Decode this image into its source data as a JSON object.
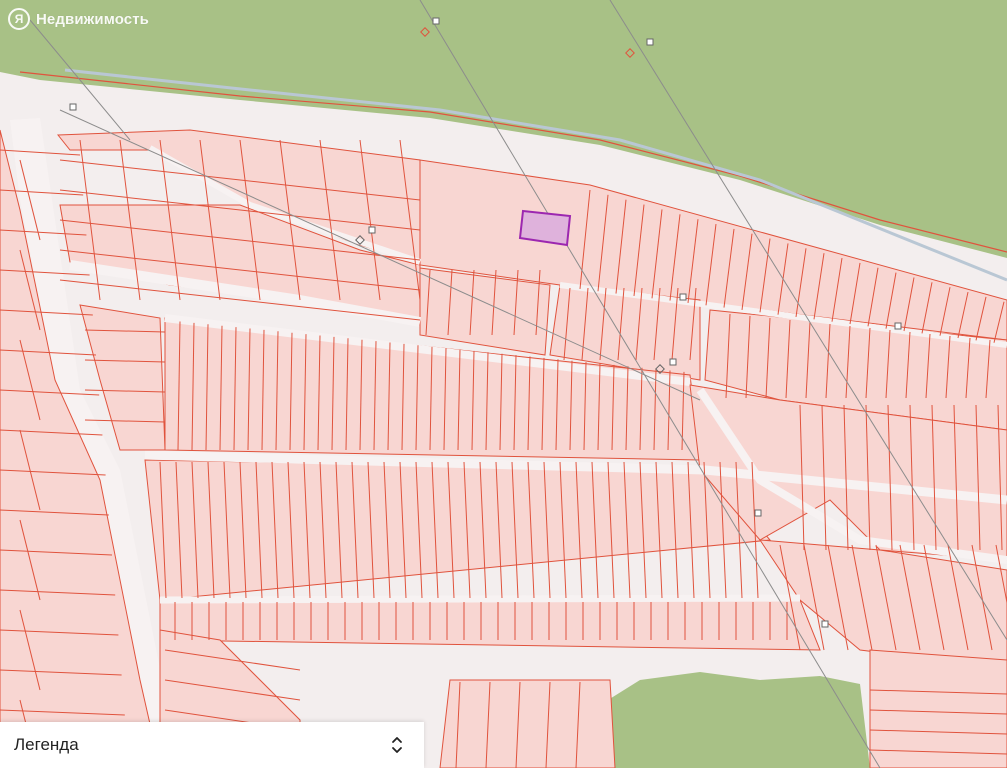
{
  "brand": {
    "logo_glyph": "Я",
    "text": "Недвижимость"
  },
  "legend": {
    "label": "Легенда",
    "toggle_icon": "chevron-up-down-icon"
  },
  "map": {
    "colors": {
      "background": "#f3eeee",
      "forest": "#a8c186",
      "parcel_fill": "#f8d6d2",
      "parcel_border": "#e0533d",
      "road": "#f7f2f2",
      "utility_line": "#8c8c8c",
      "selected_fill": "#dfb2dc",
      "selected_border": "#9c27b0"
    },
    "selected_parcel": "selected-parcel"
  }
}
